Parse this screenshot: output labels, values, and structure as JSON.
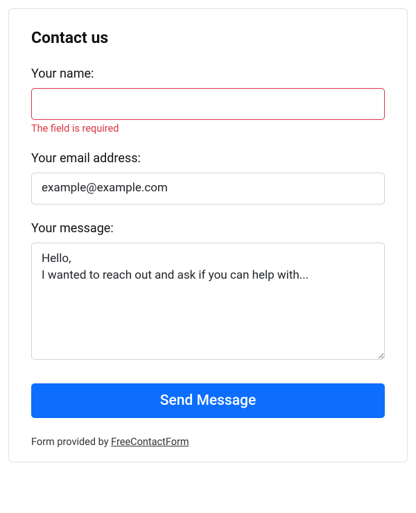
{
  "title": "Contact us",
  "fields": {
    "name": {
      "label": "Your name:",
      "value": "",
      "error": "The field is required"
    },
    "email": {
      "label": "Your email address:",
      "value": "example@example.com"
    },
    "message": {
      "label": "Your message:",
      "value": "Hello,\nI wanted to reach out and ask if you can help with..."
    }
  },
  "submit_label": "Send Message",
  "footer": {
    "prefix": "Form provided by ",
    "link_text": "FreeContactForm"
  }
}
